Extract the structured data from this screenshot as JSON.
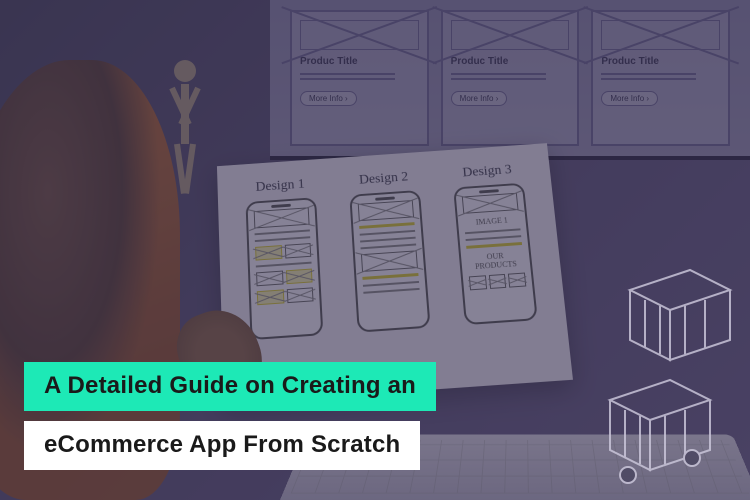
{
  "headline": {
    "line1": "A Detailed Guide on Creating an",
    "line2": "eCommerce App From Scratch"
  },
  "colors": {
    "accent": "#1de9b6",
    "secondary": "#ffffff",
    "text": "#1a1a1a"
  },
  "paper_sketches": {
    "labels": [
      "Design 1",
      "Design 2",
      "Design 3"
    ],
    "row_label": "OUR PRODUCTS",
    "image_label": "IMAGE 1"
  },
  "monitor_cards": {
    "title": "Produc Title",
    "button": "More Info  ›"
  }
}
